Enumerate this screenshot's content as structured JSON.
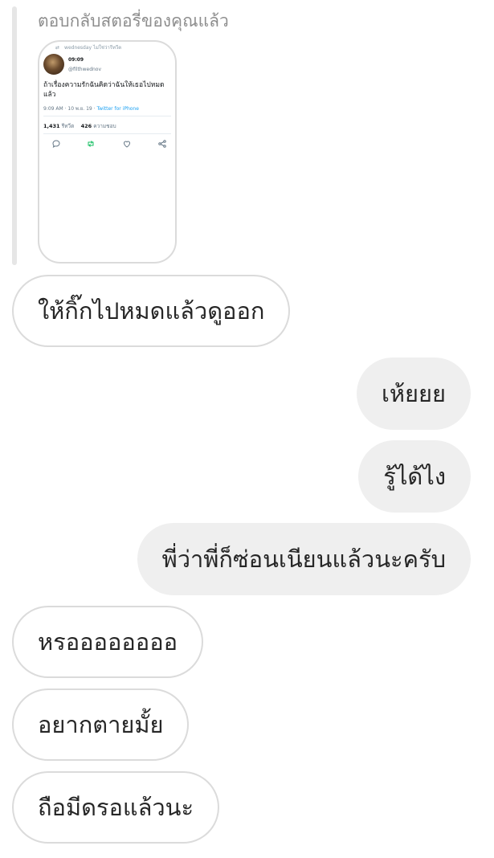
{
  "reply": {
    "header": "ตอบกลับสตอรี่ของคุณแล้ว"
  },
  "story": {
    "retweet_line": "wednesday ไม่ใช่ว่ารีทวีต",
    "tweet_name": "09:09",
    "tweet_handle": "@filthwednov",
    "tweet_text": "ถ้าเรื่องความรักฉันคิดว่าฉันให้เธอไปหมดแล้ว",
    "tweet_time": "9:09 AM · 10 พ.ย. 19 ·",
    "tweet_source": "Twitter for iPhone",
    "retweets_count": "1,431",
    "retweets_label": "รีทวีต",
    "likes_count": "426",
    "likes_label": "ความชอบ",
    "action_icons": [
      "reply-icon",
      "retweet-icon",
      "like-icon",
      "share-icon"
    ],
    "colors": {
      "link": "#1da1f2",
      "retweet": "#17bf63",
      "muted": "#657786"
    }
  },
  "messages": [
    {
      "direction": "incoming",
      "text": "ให้กิ๊กไปหมดแล้วดูออก"
    },
    {
      "direction": "outgoing",
      "text": "เห้ยยย"
    },
    {
      "direction": "outgoing",
      "text": "รู้ได้ไง"
    },
    {
      "direction": "outgoing",
      "text": "พี่ว่าพี่ก็ซ่อนเนียนแล้วนะครับ"
    },
    {
      "direction": "incoming",
      "text": "หรออออออออ"
    },
    {
      "direction": "incoming",
      "text": "อยากตายมั้ย"
    },
    {
      "direction": "incoming",
      "text": "ถือมีดรอแล้วนะ"
    }
  ],
  "colors": {
    "incoming_border": "#dbdbdb",
    "outgoing_background": "#efefef",
    "text": "#262626",
    "muted": "#8e8e8e"
  }
}
